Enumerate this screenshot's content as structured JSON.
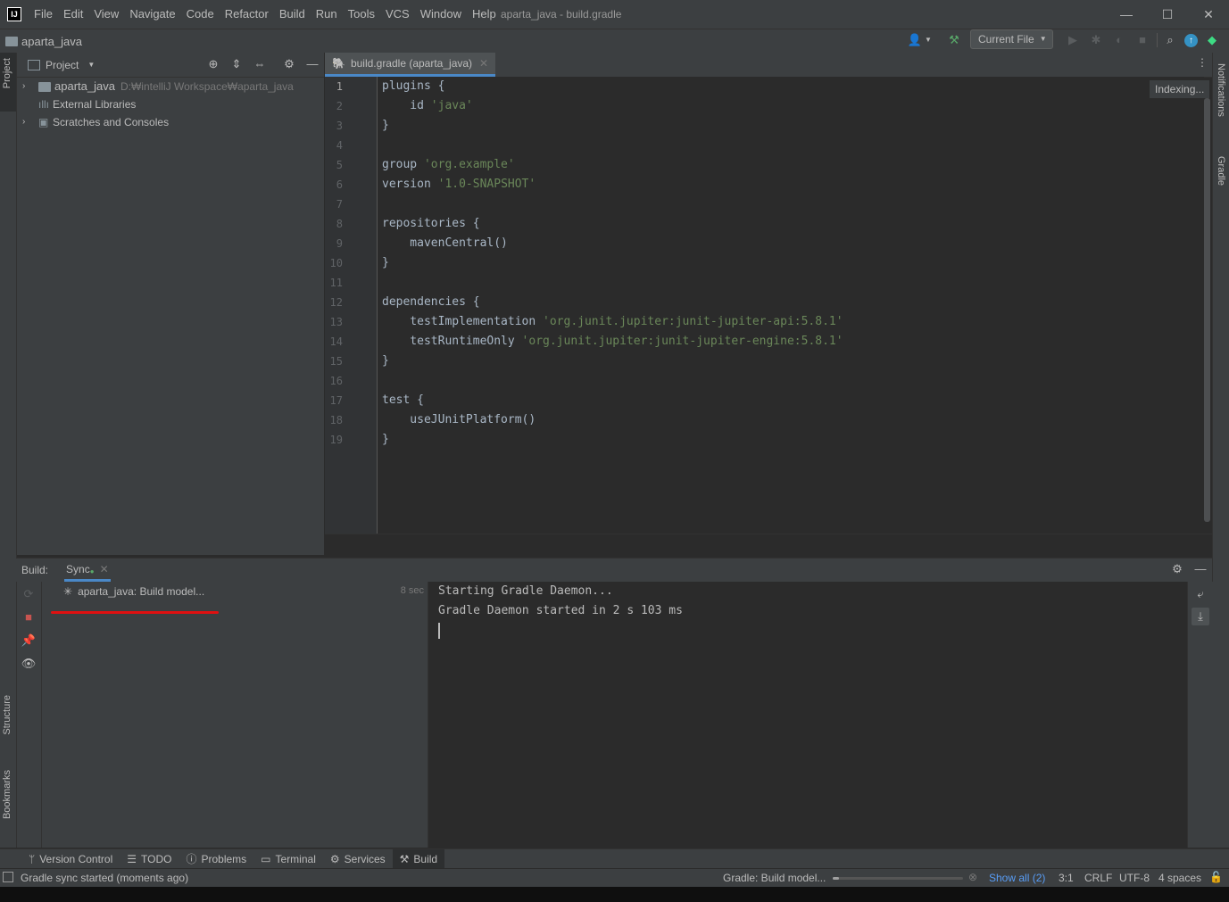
{
  "menu": [
    "File",
    "Edit",
    "View",
    "Navigate",
    "Code",
    "Refactor",
    "Build",
    "Run",
    "Tools",
    "VCS",
    "Window",
    "Help"
  ],
  "window_title": "aparta_java - build.gradle",
  "window_controls": {
    "minimize": "—",
    "maximize": "☐",
    "close": "✕"
  },
  "breadcrumb": "aparta_java",
  "run_config": "Current File",
  "left_stripe": {
    "project": "Project",
    "structure": "Structure",
    "bookmarks": "Bookmarks"
  },
  "right_stripe": {
    "notifications": "Notifications",
    "gradle": "Gradle"
  },
  "project_panel": {
    "title": "Project",
    "tree": [
      {
        "name": "aparta_java",
        "path": "D:₩intelliJ Workspace₩aparta_java"
      },
      {
        "name": "External Libraries"
      },
      {
        "name": "Scratches and Consoles"
      }
    ]
  },
  "editor": {
    "tab_label": "build.gradle (aparta_java)",
    "indexing": "Indexing...",
    "line_numbers": [
      "1",
      "2",
      "3",
      "4",
      "5",
      "6",
      "7",
      "8",
      "9",
      "10",
      "11",
      "12",
      "13",
      "14",
      "15",
      "16",
      "17",
      "18",
      "19"
    ],
    "lines": [
      {
        "t": "plugins {",
        "s": ""
      },
      {
        "t": "    id ",
        "s": "'java'"
      },
      {
        "t": "}",
        "s": ""
      },
      {
        "t": "",
        "s": ""
      },
      {
        "t": "group ",
        "s": "'org.example'"
      },
      {
        "t": "version ",
        "s": "'1.0-SNAPSHOT'"
      },
      {
        "t": "",
        "s": ""
      },
      {
        "t": "repositories {",
        "s": ""
      },
      {
        "t": "    mavenCentral()",
        "s": ""
      },
      {
        "t": "}",
        "s": ""
      },
      {
        "t": "",
        "s": ""
      },
      {
        "t": "dependencies {",
        "s": ""
      },
      {
        "t": "    testImplementation ",
        "s": "'org.junit.jupiter:junit-jupiter-api:5.8.1'"
      },
      {
        "t": "    testRuntimeOnly ",
        "s": "'org.junit.jupiter:junit-jupiter-engine:5.8.1'"
      },
      {
        "t": "}",
        "s": ""
      },
      {
        "t": "",
        "s": ""
      },
      {
        "t": "test {",
        "s": ""
      },
      {
        "t": "    useJUnitPlatform()",
        "s": ""
      },
      {
        "t": "}",
        "s": ""
      }
    ]
  },
  "build": {
    "label": "Build:",
    "tab": "Sync",
    "tree_item": "aparta_java: Build model...",
    "elapsed": "8 sec",
    "console": [
      "Starting Gradle Daemon...",
      "Gradle Daemon started in 2 s 103 ms"
    ]
  },
  "bottom_tabs": [
    "Version Control",
    "TODO",
    "Problems",
    "Terminal",
    "Services",
    "Build"
  ],
  "status": {
    "message": "Gradle sync started (moments ago)",
    "progress_label": "Gradle: Build model...",
    "progress_fraction": 0.05,
    "show_all": "Show all (2)",
    "position": "3:1",
    "line_sep": "CRLF",
    "encoding": "UTF-8",
    "indent": "4 spaces"
  },
  "colors": {
    "accent": "#4a88c7",
    "string": "#6a8759",
    "underline": "#e01010"
  }
}
